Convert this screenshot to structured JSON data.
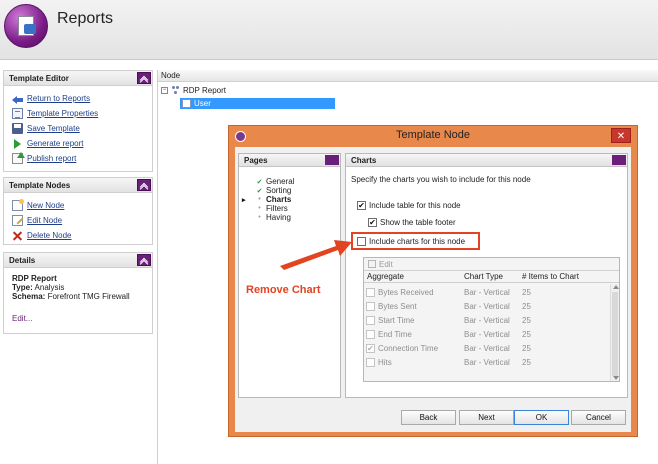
{
  "app": {
    "title": "Reports"
  },
  "template_editor": {
    "title": "Template Editor",
    "links": [
      "Return to Reports",
      "Template Properties",
      "Save Template",
      "Generate report",
      "Publish report"
    ]
  },
  "template_nodes": {
    "title": "Template Nodes",
    "links": [
      "New Node",
      "Edit Node",
      "Delete Node"
    ]
  },
  "details": {
    "title": "Details",
    "report_name": "RDP Report",
    "type_label": "Type:",
    "type_value": "Analysis",
    "schema_label": "Schema:",
    "schema_value": "Forefront TMG Firewall",
    "edit_link": "Edit..."
  },
  "tree": {
    "header": "Node",
    "root": "RDP Report",
    "child": "User",
    "expand_symbol": "−"
  },
  "dialog": {
    "title": "Template Node",
    "close_symbol": "✕",
    "pages_title": "Pages",
    "pages": [
      {
        "label": "General",
        "status": "done"
      },
      {
        "label": "Sorting",
        "status": "done"
      },
      {
        "label": "Charts",
        "status": "current"
      },
      {
        "label": "Filters",
        "status": "pending"
      },
      {
        "label": "Having",
        "status": "pending"
      }
    ],
    "check_glyph": "✔",
    "bullet_glyph": "•",
    "pointer_glyph": "▸",
    "charts_title": "Charts",
    "description": "Specify the charts you wish to include for this node",
    "include_table": {
      "label": "Include table for this node",
      "checked": true
    },
    "show_footer": {
      "label": "Show the table footer",
      "checked": true
    },
    "include_charts": {
      "label": "Include charts for this node",
      "checked": false
    },
    "grid": {
      "toolbar_edit": "Edit",
      "columns": [
        "Aggregate",
        "Chart Type",
        "# Items to Chart"
      ],
      "rows": [
        {
          "aggregate": "Bytes Received",
          "chart_type": "Bar - Vertical",
          "items": "25",
          "checked": false
        },
        {
          "aggregate": "Bytes Sent",
          "chart_type": "Bar - Vertical",
          "items": "25",
          "checked": false
        },
        {
          "aggregate": "Start Time",
          "chart_type": "Bar - Vertical",
          "items": "25",
          "checked": false
        },
        {
          "aggregate": "End Time",
          "chart_type": "Bar - Vertical",
          "items": "25",
          "checked": false
        },
        {
          "aggregate": "Connection Time",
          "chart_type": "Bar - Vertical",
          "items": "25",
          "checked": true
        },
        {
          "aggregate": "Hits",
          "chart_type": "Bar - Vertical",
          "items": "25",
          "checked": false
        }
      ]
    },
    "buttons": {
      "back": "Back",
      "next": "Next",
      "ok": "OK",
      "cancel": "Cancel"
    }
  },
  "annotation": {
    "text": "Remove Chart",
    "color": "#e24321"
  },
  "colors": {
    "accent_purple": "#6a1f7a",
    "dialog_frame": "#e9884b",
    "close_red": "#c7372c",
    "selection_blue": "#3399ff"
  }
}
